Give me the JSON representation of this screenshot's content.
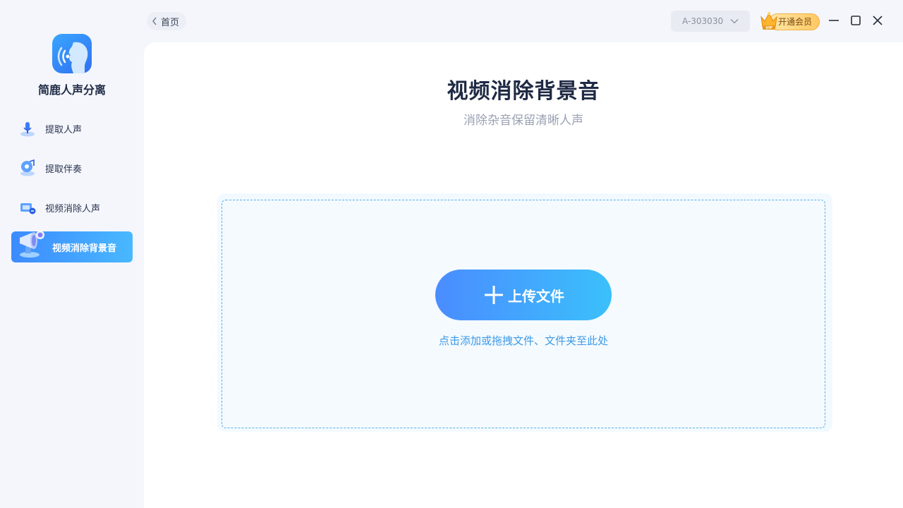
{
  "app": {
    "name": "简鹿人声分离"
  },
  "nav": {
    "items": [
      {
        "label": "提取人声",
        "icon": "vocal-extract-icon"
      },
      {
        "label": "提取伴奏",
        "icon": "accompaniment-extract-icon"
      },
      {
        "label": "视频消除人声",
        "icon": "video-remove-vocal-icon"
      },
      {
        "label": "视频消除背景音",
        "icon": "video-remove-background-icon",
        "active": true
      }
    ]
  },
  "topbar": {
    "home_label": "首页",
    "account_id": "A-303030",
    "vip_label": "开通会员",
    "vip_badge": "VIP"
  },
  "main": {
    "title": "视频消除背景音",
    "subtitle": "消除杂音保留清晰人声",
    "upload_label": "上传文件",
    "hint": "点击添加或拖拽文件、文件夹至此处"
  },
  "colors": {
    "accent_start": "#4a8cff",
    "accent_end": "#3bc0fb",
    "hint": "#3d9ae8",
    "vip_gold": "#ffc862"
  }
}
